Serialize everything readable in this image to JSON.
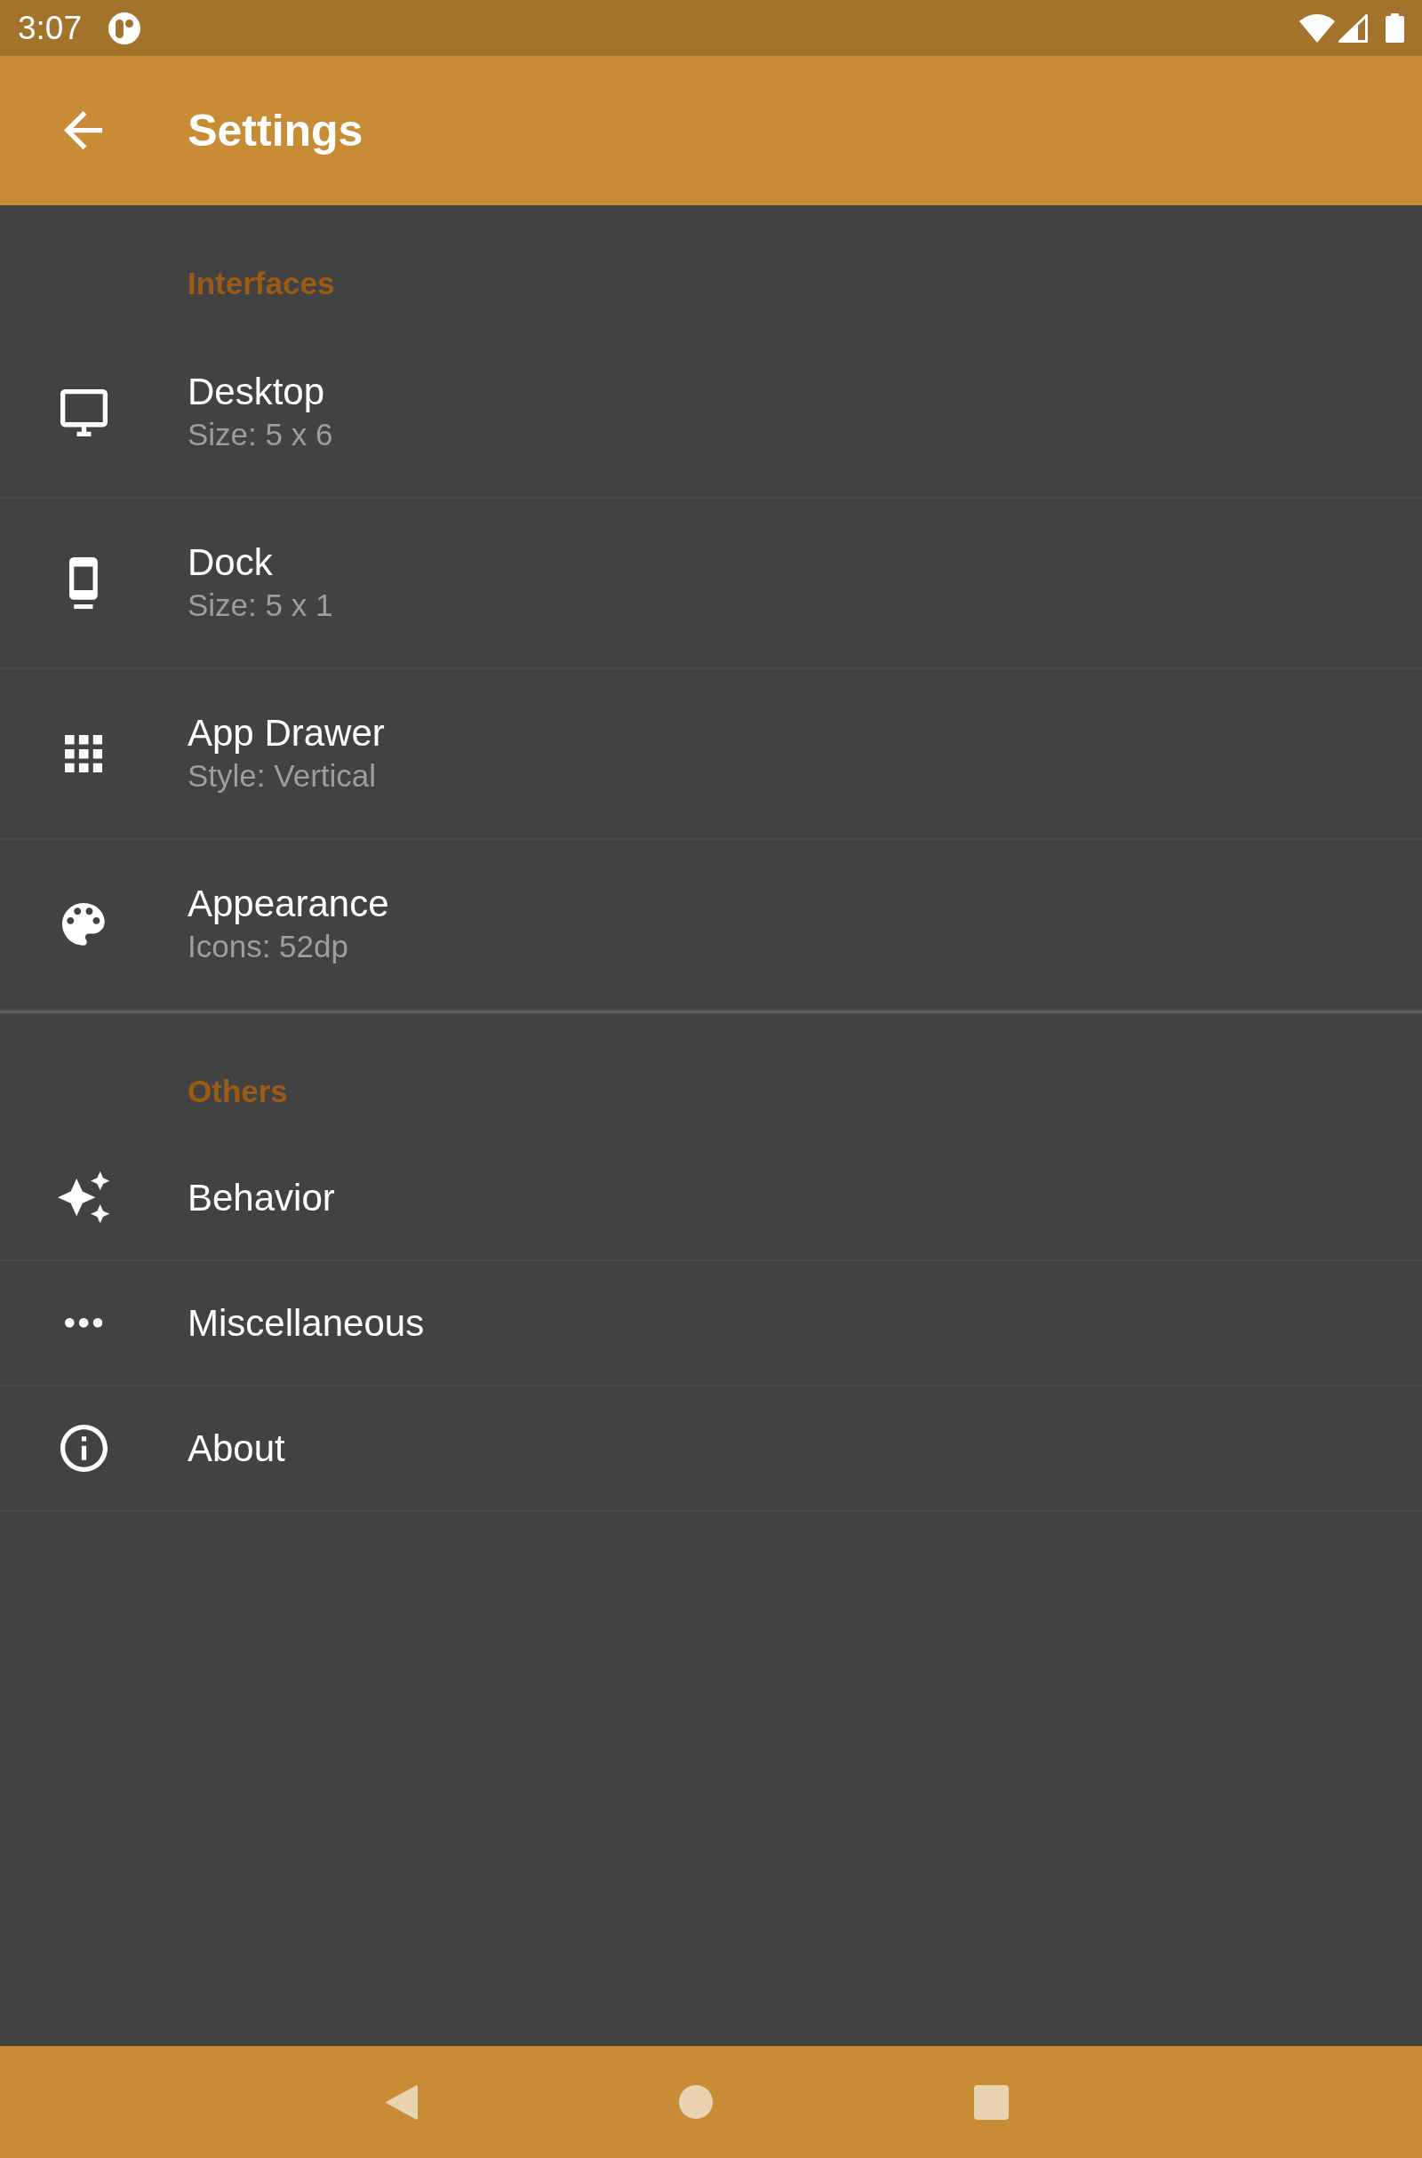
{
  "status_bar": {
    "time": "3:07"
  },
  "app_bar": {
    "title": "Settings"
  },
  "sections": [
    {
      "header": "Interfaces",
      "items": [
        {
          "title": "Desktop",
          "summary": "Size: 5 x 6"
        },
        {
          "title": "Dock",
          "summary": "Size: 5 x 1"
        },
        {
          "title": "App Drawer",
          "summary": "Style: Vertical"
        },
        {
          "title": "Appearance",
          "summary": "Icons: 52dp"
        }
      ]
    },
    {
      "header": "Others",
      "items": [
        {
          "title": "Behavior"
        },
        {
          "title": "Miscellaneous"
        },
        {
          "title": "About"
        }
      ]
    }
  ]
}
